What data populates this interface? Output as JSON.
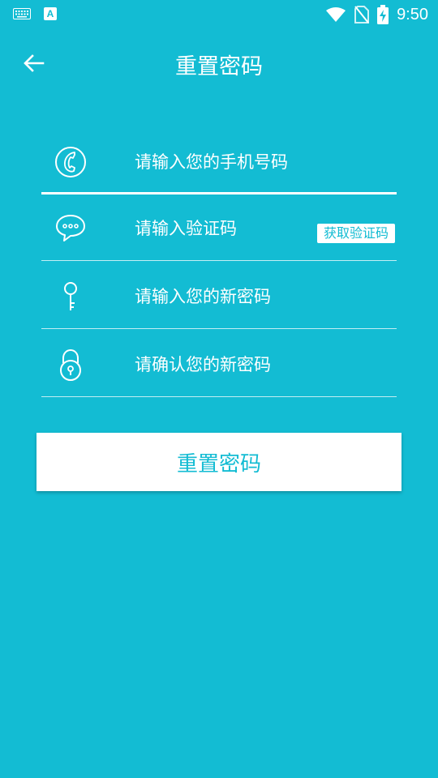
{
  "status_bar": {
    "time": "9:50",
    "left_icons": [
      "keyboard-icon",
      "a-app-icon"
    ],
    "right_icons": [
      "wifi-icon",
      "no-sim-icon",
      "battery-charging-icon"
    ]
  },
  "header": {
    "title": "重置密码",
    "back_icon": "arrow-left-icon"
  },
  "form": {
    "phone": {
      "placeholder": "请输入您的手机号码",
      "value": "",
      "icon": "phone-icon"
    },
    "code": {
      "placeholder": "请输入验证码",
      "value": "",
      "icon": "chat-bubble-icon",
      "button_label": "获取验证码"
    },
    "new_password": {
      "placeholder": "请输入您的新密码",
      "value": "",
      "icon": "key-icon"
    },
    "confirm_password": {
      "placeholder": "请确认您的新密码",
      "value": "",
      "icon": "lock-icon"
    }
  },
  "submit": {
    "label": "重置密码"
  },
  "colors": {
    "background": "#13bcd3",
    "foreground": "#ffffff",
    "accent": "#13bcd3"
  }
}
